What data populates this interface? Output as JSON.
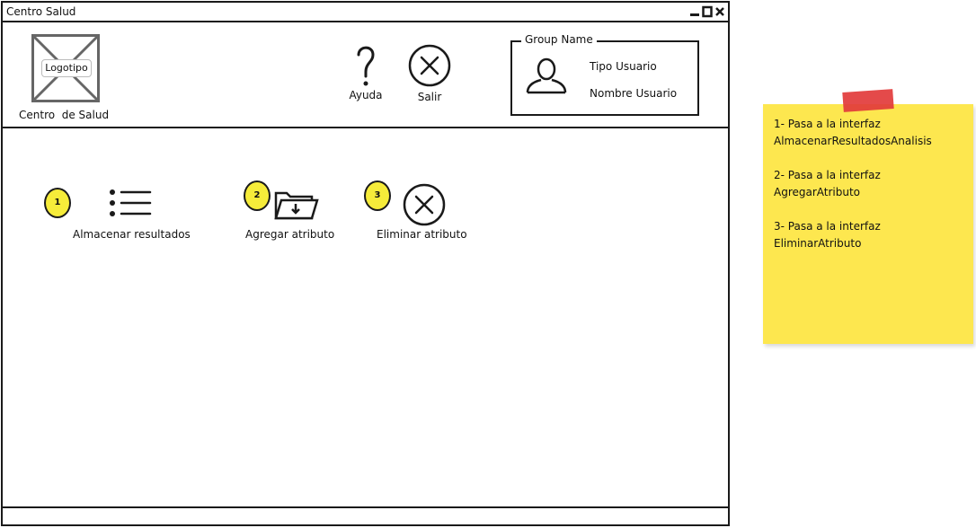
{
  "window": {
    "title": "Centro Salud",
    "controls": [
      "minimize-icon",
      "maximize-icon",
      "close-icon"
    ]
  },
  "header": {
    "logo_placeholder": "Logotipo",
    "org_name": "Centro  de Salud",
    "help_label": "Ayuda",
    "exit_label": "Salir",
    "group": {
      "legend": "Group Name",
      "user_type": "Tipo Usuario",
      "user_name": "Nombre Usuario"
    }
  },
  "actions": [
    {
      "number": "1",
      "label": "Almacenar resultados",
      "icon": "list-icon"
    },
    {
      "number": "2",
      "label": "Agregar atributo",
      "icon": "folder-import-icon"
    },
    {
      "number": "3",
      "label": "Eliminar atributo",
      "icon": "close-circle-icon"
    }
  ],
  "note": {
    "lines": [
      "1- Pasa a la interfaz",
      "AlmacenarResultadosAnalisis",
      "2- Pasa a la interfaz",
      "AgregarAtributo",
      "3- Pasa a la interfaz",
      "EliminarAtributo"
    ]
  },
  "colors": {
    "badge": "#f6ec3a",
    "note": "#fde74f",
    "tape": "#e23b3b",
    "line": "#1a1a1a"
  }
}
